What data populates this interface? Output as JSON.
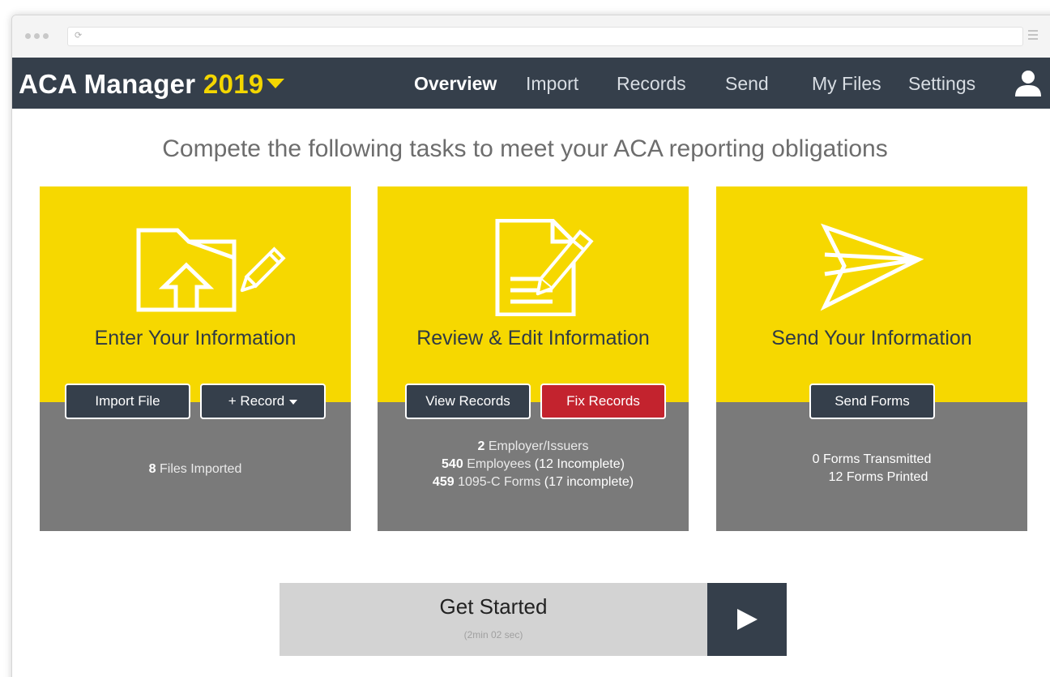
{
  "browser": {
    "reload_icon": "reload-icon",
    "menu_icon": "hamburger-icon"
  },
  "navbar": {
    "brand": "ACA Manager",
    "year": "2019",
    "links": [
      {
        "label": "Overview",
        "active": true
      },
      {
        "label": "Import",
        "active": false
      },
      {
        "label": "Records",
        "active": false
      },
      {
        "label": "Send",
        "active": false
      },
      {
        "label": "My Files",
        "active": false
      },
      {
        "label": "Settings",
        "active": false
      }
    ],
    "user_icon": "user-icon"
  },
  "headline": "Compete the following tasks to meet your ACA reporting obligations",
  "cards": {
    "enter": {
      "title": "Enter Your Information",
      "icon": "folder-upload-pencil-icon",
      "buttons": {
        "import": "Import File",
        "record": "+ Record"
      },
      "stats": {
        "files_count": "8",
        "files_label": "Files Imported"
      }
    },
    "review": {
      "title": "Review & Edit Information",
      "icon": "document-pencil-icon",
      "buttons": {
        "view": "View Records",
        "fix": "Fix Records"
      },
      "stats": {
        "employers_count": "2",
        "employers_label": "Employer/Issuers",
        "employees_count": "540",
        "employees_label": "Employees",
        "employees_note": "(12 Incomplete)",
        "forms_count": "459",
        "forms_label": "1095-C Forms",
        "forms_note": "(17 incomplete)"
      }
    },
    "send": {
      "title": "Send Your Information",
      "icon": "paper-plane-icon",
      "buttons": {
        "send": "Send Forms"
      },
      "stats": {
        "transmitted": "0 Forms Transmitted",
        "printed": "12 Forms Printed"
      }
    }
  },
  "get_started": {
    "title": "Get Started",
    "duration": "(2min 02 sec)",
    "play_icon": "play-icon"
  },
  "colors": {
    "accent_yellow": "#f6d800",
    "navbar": "#353f4b",
    "card_bottom": "#7a7a7a",
    "danger": "#c3232e"
  }
}
